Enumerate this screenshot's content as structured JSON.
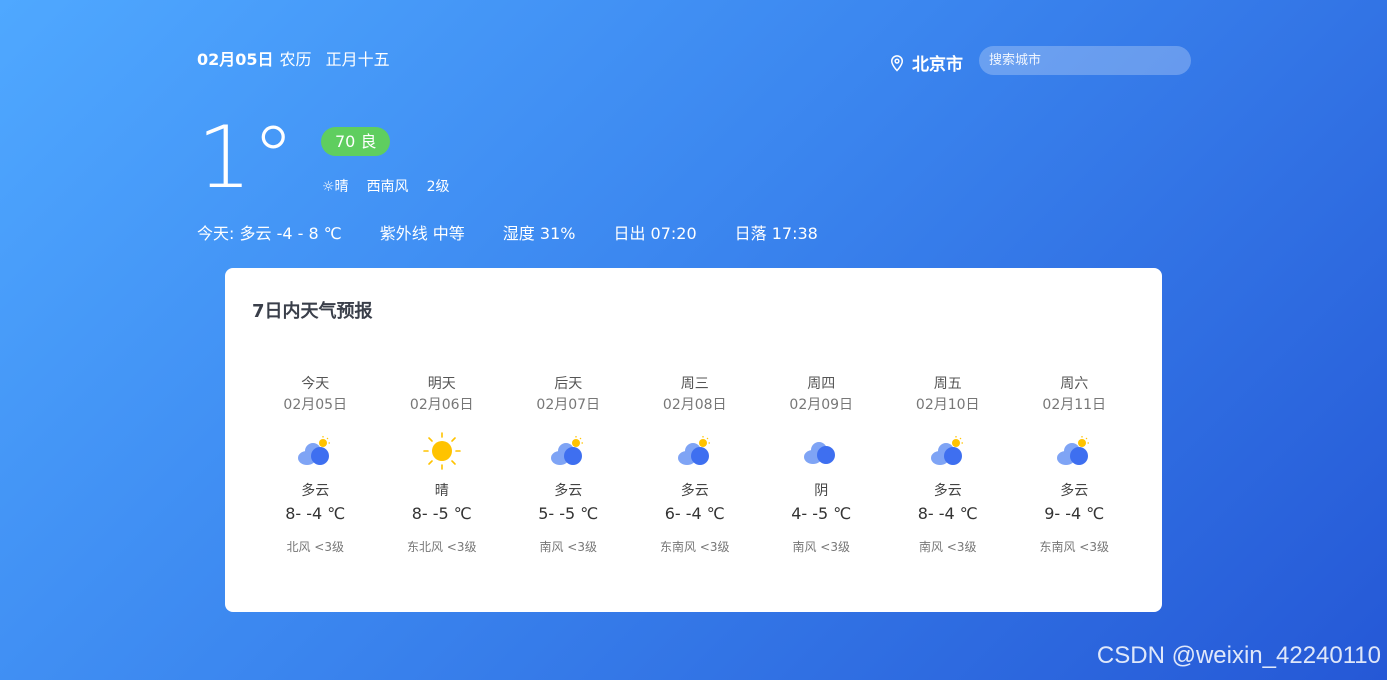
{
  "header": {
    "date": "02月05日",
    "lunar_label": "农历",
    "lunar_date": "正月十五",
    "city": "北京市",
    "search_placeholder": "搜索城市"
  },
  "current": {
    "temperature": "1°",
    "aqi": "70 良",
    "condition": "☼晴",
    "wind_dir": "西南风",
    "wind_level": "2级"
  },
  "today": {
    "summary": "今天:  多云 -4 - 8 ℃",
    "uv": "紫外线 中等",
    "humidity": "湿度 31%",
    "sunrise": "日出 07:20",
    "sunset": "日落 17:38"
  },
  "forecast": {
    "title": "7日内天气预报",
    "days": [
      {
        "week": "今天",
        "date": "02月05日",
        "icon": "partly-cloudy",
        "desc": "多云",
        "temp": "8- -4 ℃",
        "wind": "北风 <3级"
      },
      {
        "week": "明天",
        "date": "02月06日",
        "icon": "sunny",
        "desc": "晴",
        "temp": "8- -5 ℃",
        "wind": "东北风 <3级"
      },
      {
        "week": "后天",
        "date": "02月07日",
        "icon": "partly-cloudy",
        "desc": "多云",
        "temp": "5- -5 ℃",
        "wind": "南风 <3级"
      },
      {
        "week": "周三",
        "date": "02月08日",
        "icon": "partly-cloudy",
        "desc": "多云",
        "temp": "6- -4 ℃",
        "wind": "东南风 <3级"
      },
      {
        "week": "周四",
        "date": "02月09日",
        "icon": "overcast",
        "desc": "阴",
        "temp": "4- -5 ℃",
        "wind": "南风 <3级"
      },
      {
        "week": "周五",
        "date": "02月10日",
        "icon": "partly-cloudy",
        "desc": "多云",
        "temp": "8- -4 ℃",
        "wind": "南风 <3级"
      },
      {
        "week": "周六",
        "date": "02月11日",
        "icon": "partly-cloudy",
        "desc": "多云",
        "temp": "9- -4 ℃",
        "wind": "东南风 <3级"
      }
    ]
  },
  "watermark": "CSDN @weixin_42240110",
  "colors": {
    "aqi_good": "#5fce5f",
    "cloud_dark": "#3e6ff0",
    "cloud_light": "#7fa4f5",
    "sun": "#ffc300"
  }
}
